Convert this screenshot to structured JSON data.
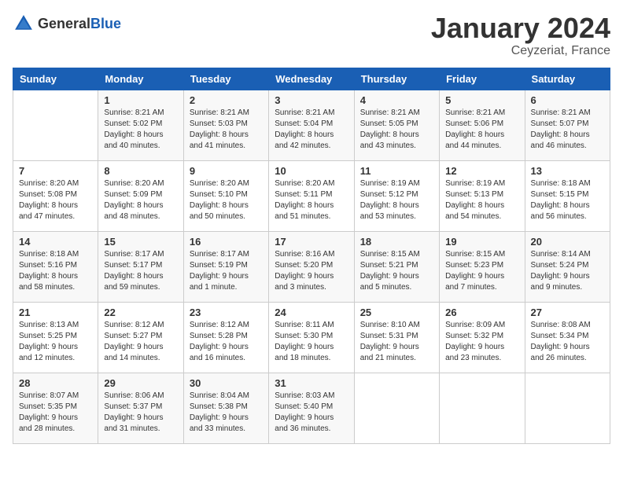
{
  "header": {
    "logo_general": "General",
    "logo_blue": "Blue",
    "month_year": "January 2024",
    "location": "Ceyzeriat, France"
  },
  "weekdays": [
    "Sunday",
    "Monday",
    "Tuesday",
    "Wednesday",
    "Thursday",
    "Friday",
    "Saturday"
  ],
  "weeks": [
    [
      {
        "day": "",
        "sunrise": "",
        "sunset": "",
        "daylight": ""
      },
      {
        "day": "1",
        "sunrise": "Sunrise: 8:21 AM",
        "sunset": "Sunset: 5:02 PM",
        "daylight": "Daylight: 8 hours and 40 minutes."
      },
      {
        "day": "2",
        "sunrise": "Sunrise: 8:21 AM",
        "sunset": "Sunset: 5:03 PM",
        "daylight": "Daylight: 8 hours and 41 minutes."
      },
      {
        "day": "3",
        "sunrise": "Sunrise: 8:21 AM",
        "sunset": "Sunset: 5:04 PM",
        "daylight": "Daylight: 8 hours and 42 minutes."
      },
      {
        "day": "4",
        "sunrise": "Sunrise: 8:21 AM",
        "sunset": "Sunset: 5:05 PM",
        "daylight": "Daylight: 8 hours and 43 minutes."
      },
      {
        "day": "5",
        "sunrise": "Sunrise: 8:21 AM",
        "sunset": "Sunset: 5:06 PM",
        "daylight": "Daylight: 8 hours and 44 minutes."
      },
      {
        "day": "6",
        "sunrise": "Sunrise: 8:21 AM",
        "sunset": "Sunset: 5:07 PM",
        "daylight": "Daylight: 8 hours and 46 minutes."
      }
    ],
    [
      {
        "day": "7",
        "sunrise": "Sunrise: 8:20 AM",
        "sunset": "Sunset: 5:08 PM",
        "daylight": "Daylight: 8 hours and 47 minutes."
      },
      {
        "day": "8",
        "sunrise": "Sunrise: 8:20 AM",
        "sunset": "Sunset: 5:09 PM",
        "daylight": "Daylight: 8 hours and 48 minutes."
      },
      {
        "day": "9",
        "sunrise": "Sunrise: 8:20 AM",
        "sunset": "Sunset: 5:10 PM",
        "daylight": "Daylight: 8 hours and 50 minutes."
      },
      {
        "day": "10",
        "sunrise": "Sunrise: 8:20 AM",
        "sunset": "Sunset: 5:11 PM",
        "daylight": "Daylight: 8 hours and 51 minutes."
      },
      {
        "day": "11",
        "sunrise": "Sunrise: 8:19 AM",
        "sunset": "Sunset: 5:12 PM",
        "daylight": "Daylight: 8 hours and 53 minutes."
      },
      {
        "day": "12",
        "sunrise": "Sunrise: 8:19 AM",
        "sunset": "Sunset: 5:13 PM",
        "daylight": "Daylight: 8 hours and 54 minutes."
      },
      {
        "day": "13",
        "sunrise": "Sunrise: 8:18 AM",
        "sunset": "Sunset: 5:15 PM",
        "daylight": "Daylight: 8 hours and 56 minutes."
      }
    ],
    [
      {
        "day": "14",
        "sunrise": "Sunrise: 8:18 AM",
        "sunset": "Sunset: 5:16 PM",
        "daylight": "Daylight: 8 hours and 58 minutes."
      },
      {
        "day": "15",
        "sunrise": "Sunrise: 8:17 AM",
        "sunset": "Sunset: 5:17 PM",
        "daylight": "Daylight: 8 hours and 59 minutes."
      },
      {
        "day": "16",
        "sunrise": "Sunrise: 8:17 AM",
        "sunset": "Sunset: 5:19 PM",
        "daylight": "Daylight: 9 hours and 1 minute."
      },
      {
        "day": "17",
        "sunrise": "Sunrise: 8:16 AM",
        "sunset": "Sunset: 5:20 PM",
        "daylight": "Daylight: 9 hours and 3 minutes."
      },
      {
        "day": "18",
        "sunrise": "Sunrise: 8:15 AM",
        "sunset": "Sunset: 5:21 PM",
        "daylight": "Daylight: 9 hours and 5 minutes."
      },
      {
        "day": "19",
        "sunrise": "Sunrise: 8:15 AM",
        "sunset": "Sunset: 5:23 PM",
        "daylight": "Daylight: 9 hours and 7 minutes."
      },
      {
        "day": "20",
        "sunrise": "Sunrise: 8:14 AM",
        "sunset": "Sunset: 5:24 PM",
        "daylight": "Daylight: 9 hours and 9 minutes."
      }
    ],
    [
      {
        "day": "21",
        "sunrise": "Sunrise: 8:13 AM",
        "sunset": "Sunset: 5:25 PM",
        "daylight": "Daylight: 9 hours and 12 minutes."
      },
      {
        "day": "22",
        "sunrise": "Sunrise: 8:12 AM",
        "sunset": "Sunset: 5:27 PM",
        "daylight": "Daylight: 9 hours and 14 minutes."
      },
      {
        "day": "23",
        "sunrise": "Sunrise: 8:12 AM",
        "sunset": "Sunset: 5:28 PM",
        "daylight": "Daylight: 9 hours and 16 minutes."
      },
      {
        "day": "24",
        "sunrise": "Sunrise: 8:11 AM",
        "sunset": "Sunset: 5:30 PM",
        "daylight": "Daylight: 9 hours and 18 minutes."
      },
      {
        "day": "25",
        "sunrise": "Sunrise: 8:10 AM",
        "sunset": "Sunset: 5:31 PM",
        "daylight": "Daylight: 9 hours and 21 minutes."
      },
      {
        "day": "26",
        "sunrise": "Sunrise: 8:09 AM",
        "sunset": "Sunset: 5:32 PM",
        "daylight": "Daylight: 9 hours and 23 minutes."
      },
      {
        "day": "27",
        "sunrise": "Sunrise: 8:08 AM",
        "sunset": "Sunset: 5:34 PM",
        "daylight": "Daylight: 9 hours and 26 minutes."
      }
    ],
    [
      {
        "day": "28",
        "sunrise": "Sunrise: 8:07 AM",
        "sunset": "Sunset: 5:35 PM",
        "daylight": "Daylight: 9 hours and 28 minutes."
      },
      {
        "day": "29",
        "sunrise": "Sunrise: 8:06 AM",
        "sunset": "Sunset: 5:37 PM",
        "daylight": "Daylight: 9 hours and 31 minutes."
      },
      {
        "day": "30",
        "sunrise": "Sunrise: 8:04 AM",
        "sunset": "Sunset: 5:38 PM",
        "daylight": "Daylight: 9 hours and 33 minutes."
      },
      {
        "day": "31",
        "sunrise": "Sunrise: 8:03 AM",
        "sunset": "Sunset: 5:40 PM",
        "daylight": "Daylight: 9 hours and 36 minutes."
      },
      {
        "day": "",
        "sunrise": "",
        "sunset": "",
        "daylight": ""
      },
      {
        "day": "",
        "sunrise": "",
        "sunset": "",
        "daylight": ""
      },
      {
        "day": "",
        "sunrise": "",
        "sunset": "",
        "daylight": ""
      }
    ]
  ]
}
